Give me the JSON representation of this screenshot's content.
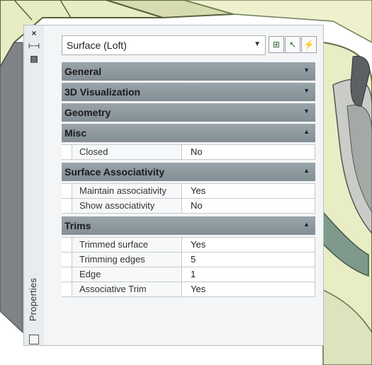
{
  "sidebar": {
    "close_glyph": "×",
    "pin_glyph": "⊢⊣",
    "menu_glyph": "▤",
    "label": "Properties"
  },
  "header": {
    "object_type": "Surface (Loft)",
    "tools": [
      "toggle-pickadd-icon",
      "select-objects-icon",
      "quick-select-icon"
    ]
  },
  "categories": [
    {
      "label": "General",
      "expanded": false,
      "rows": []
    },
    {
      "label": "3D Visualization",
      "expanded": false,
      "rows": []
    },
    {
      "label": "Geometry",
      "expanded": false,
      "rows": []
    },
    {
      "label": "Misc",
      "expanded": true,
      "rows": [
        {
          "key": "Closed",
          "value": "No"
        }
      ]
    },
    {
      "label": "Surface Associativity",
      "expanded": true,
      "rows": [
        {
          "key": "Maintain associativity",
          "value": "Yes"
        },
        {
          "key": "Show associativity",
          "value": "No"
        }
      ]
    },
    {
      "label": "Trims",
      "expanded": true,
      "rows": [
        {
          "key": "Trimmed surface",
          "value": "Yes"
        },
        {
          "key": "Trimming edges",
          "value": "5"
        },
        {
          "key": "Edge",
          "value": "1"
        },
        {
          "key": "Associative Trim",
          "value": "Yes"
        }
      ]
    }
  ],
  "colors": {
    "model_fill": "#e9efc9",
    "model_edge": "#6e7f58",
    "panel_bg": "#f3f5f6",
    "category_bg": "#8c969d"
  }
}
